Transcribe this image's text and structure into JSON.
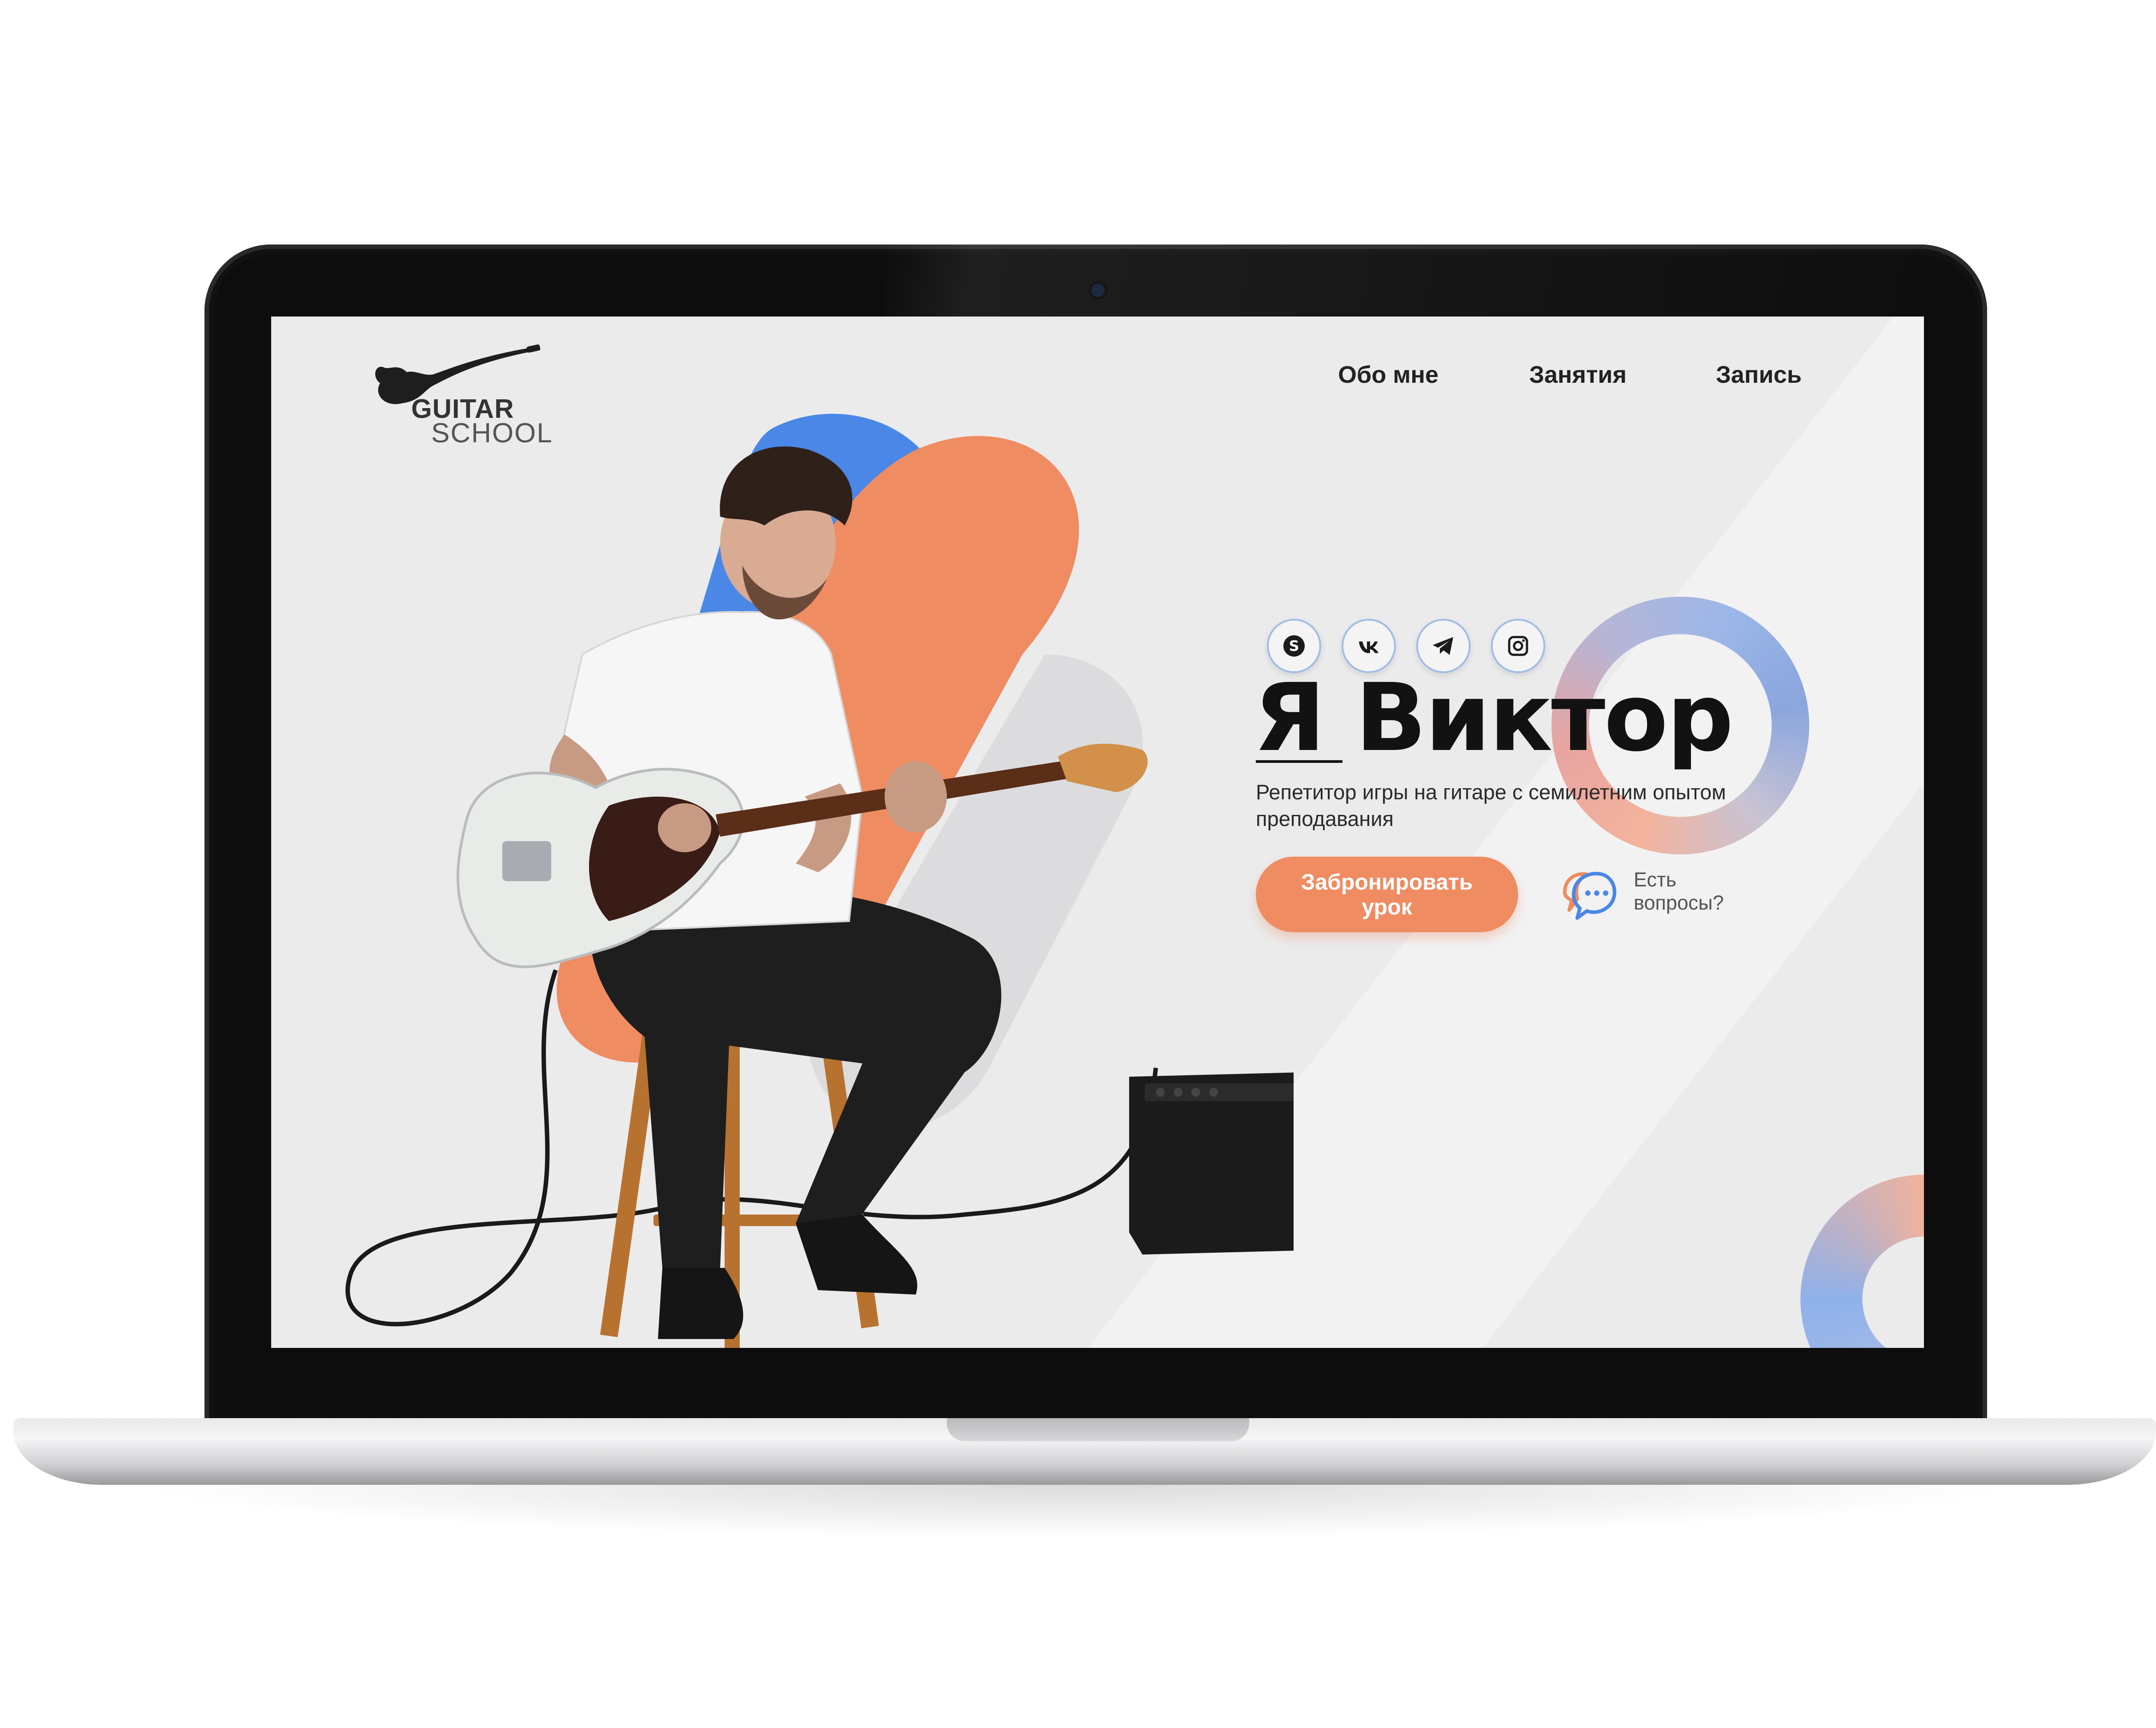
{
  "logo": {
    "title": "GUITAR",
    "subtitle": "SCHOOL"
  },
  "nav": {
    "items": [
      "Обо мне",
      "Занятия",
      "Запись"
    ]
  },
  "social": [
    {
      "icon": "skype-icon"
    },
    {
      "icon": "vk-icon"
    },
    {
      "icon": "telegram-icon"
    },
    {
      "icon": "instagram-icon"
    }
  ],
  "hero": {
    "title": "Я Виктор",
    "subtitle": "Репетитор игры на гитаре с семилетним опытом преподавания",
    "cta_label": "Забронировать урок",
    "questions_label": "Есть вопросы?"
  },
  "colors": {
    "accent": "#ef8c62",
    "blue": "#4a87e6",
    "background": "#ebebec"
  }
}
